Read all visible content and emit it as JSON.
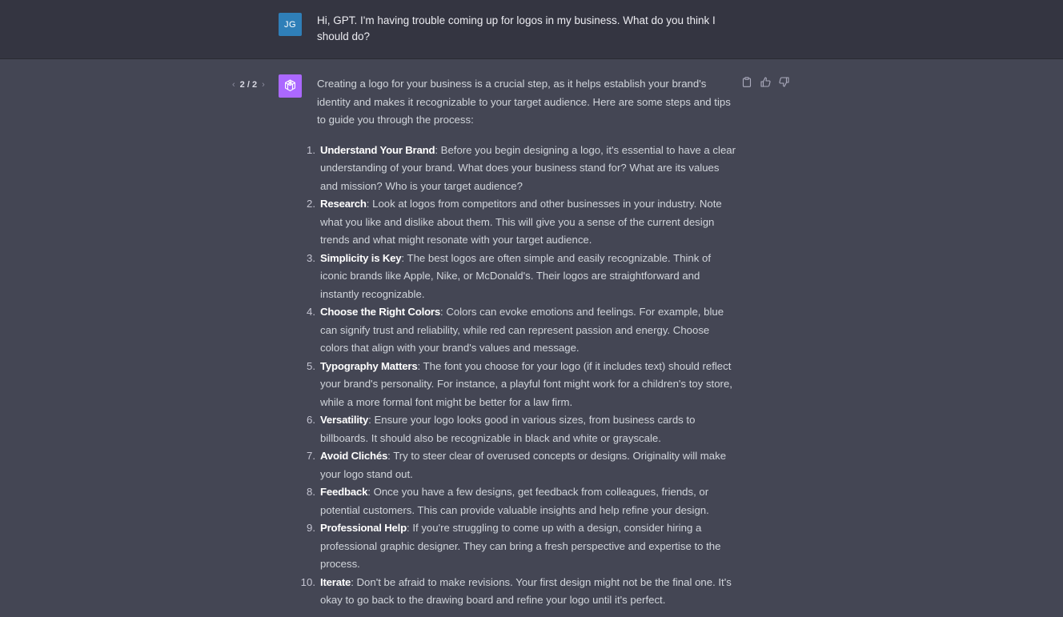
{
  "user_message": {
    "avatar_initials": "JG",
    "text": "Hi, GPT. I'm having trouble coming up for logos in my business. What do you think I should do?"
  },
  "assistant_message": {
    "pager": {
      "prev_icon": "chevron-left-icon",
      "count": "2 / 2",
      "next_icon": "chevron-right-icon"
    },
    "avatar_icon": "openai-logo-icon",
    "actions": [
      "clipboard-icon",
      "thumbs-up-icon",
      "thumbs-down-icon"
    ],
    "intro": "Creating a logo for your business is a crucial step, as it helps establish your brand's identity and makes it recognizable to your target audience. Here are some steps and tips to guide you through the process:",
    "steps": [
      {
        "num": "1.",
        "title": "Understand Your Brand",
        "text": ": Before you begin designing a logo, it's essential to have a clear understanding of your brand. What does your business stand for? What are its values and mission? Who is your target audience?"
      },
      {
        "num": "2.",
        "title": "Research",
        "text": ": Look at logos from competitors and other businesses in your industry. Note what you like and dislike about them. This will give you a sense of the current design trends and what might resonate with your target audience."
      },
      {
        "num": "3.",
        "title": "Simplicity is Key",
        "text": ": The best logos are often simple and easily recognizable. Think of iconic brands like Apple, Nike, or McDonald's. Their logos are straightforward and instantly recognizable."
      },
      {
        "num": "4.",
        "title": "Choose the Right Colors",
        "text": ": Colors can evoke emotions and feelings. For example, blue can signify trust and reliability, while red can represent passion and energy. Choose colors that align with your brand's values and message."
      },
      {
        "num": "5.",
        "title": "Typography Matters",
        "text": ": The font you choose for your logo (if it includes text) should reflect your brand's personality. For instance, a playful font might work for a children's toy store, while a more formal font might be better for a law firm."
      },
      {
        "num": "6.",
        "title": "Versatility",
        "text": ": Ensure your logo looks good in various sizes, from business cards to billboards. It should also be recognizable in black and white or grayscale."
      },
      {
        "num": "7.",
        "title": "Avoid Clichés",
        "text": ": Try to steer clear of overused concepts or designs. Originality will make your logo stand out."
      },
      {
        "num": "8.",
        "title": "Feedback",
        "text": ": Once you have a few designs, get feedback from colleagues, friends, or potential customers. This can provide valuable insights and help refine your design."
      },
      {
        "num": "9.",
        "title": "Professional Help",
        "text": ": If you're struggling to come up with a design, consider hiring a professional graphic designer. They can bring a fresh perspective and expertise to the process."
      },
      {
        "num": "10.",
        "title": "Iterate",
        "text": ": Don't be afraid to make revisions. Your first design might not be the final one. It's okay to go back to the drawing board and refine your logo until it's perfect."
      }
    ]
  },
  "colors": {
    "user_bg": "#343541",
    "assistant_bg": "#444654",
    "user_avatar": "#2f7fb8",
    "gpt_avatar": "#ab68ff"
  }
}
